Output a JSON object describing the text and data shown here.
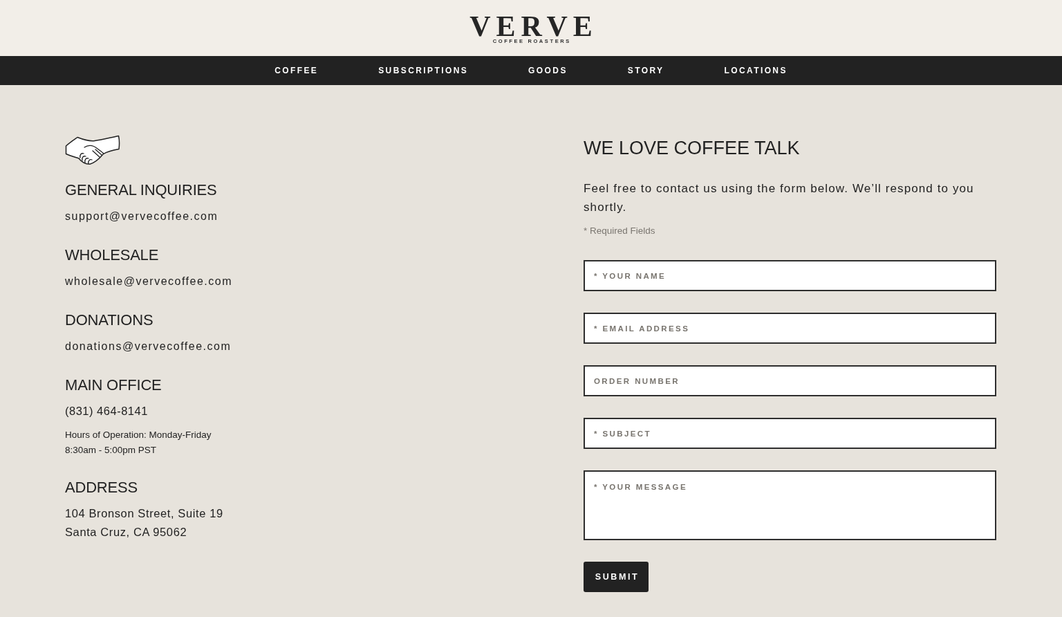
{
  "header": {
    "logo": {
      "wordmark": "VERVE",
      "tagline": "COFFEE ROASTERS"
    }
  },
  "nav": {
    "items": [
      {
        "label": "COFFEE"
      },
      {
        "label": "SUBSCRIPTIONS"
      },
      {
        "label": "GOODS"
      },
      {
        "label": "STORY"
      },
      {
        "label": "LOCATIONS"
      }
    ]
  },
  "contacts": {
    "sections": [
      {
        "heading": "GENERAL INQUIRIES",
        "lines": [
          {
            "kind": "email",
            "text": "support@vervecoffee.com"
          }
        ]
      },
      {
        "heading": "WHOLESALE",
        "lines": [
          {
            "kind": "email",
            "text": "wholesale@vervecoffee.com"
          }
        ]
      },
      {
        "heading": "DONATIONS",
        "lines": [
          {
            "kind": "email",
            "text": "donations@vervecoffee.com"
          }
        ]
      },
      {
        "heading": "MAIN OFFICE",
        "lines": [
          {
            "kind": "phone",
            "text": "(831) 464-8141"
          },
          {
            "kind": "note",
            "text": "Hours of Operation: Monday-Friday"
          },
          {
            "kind": "note",
            "text": "8:30am - 5:00pm PST"
          }
        ]
      },
      {
        "heading": "ADDRESS",
        "lines": [
          {
            "kind": "address",
            "text": "104 Bronson Street, Suite 19"
          },
          {
            "kind": "address",
            "text": "Santa Cruz, CA 95062"
          }
        ]
      }
    ]
  },
  "form": {
    "title": "WE LOVE COFFEE TALK",
    "intro": "Feel free to contact us using the form below. We’ll respond to you shortly.",
    "required_note": "* Required Fields",
    "fields": [
      {
        "kind": "input",
        "placeholder": "* YOUR NAME"
      },
      {
        "kind": "input",
        "placeholder": "* EMAIL ADDRESS"
      },
      {
        "kind": "input",
        "placeholder": "ORDER NUMBER"
      },
      {
        "kind": "input",
        "placeholder": "* SUBJECT"
      },
      {
        "kind": "textarea",
        "placeholder": "* YOUR MESSAGE"
      }
    ],
    "submit": "SUBMIT"
  }
}
